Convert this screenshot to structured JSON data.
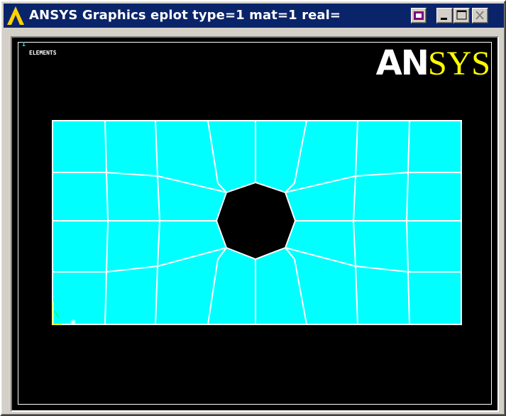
{
  "window": {
    "title": "ANSYS Graphics   eplot   type=1  mat=1  real=",
    "buttons": [
      "menu-toggle",
      "minimize",
      "maximize",
      "close"
    ]
  },
  "plot": {
    "window_number": "1",
    "label": "ELEMENTS",
    "logo_left": "AN",
    "logo_right": "SYS",
    "colors": {
      "background": "#000000",
      "mesh_fill": "#00ffff",
      "mesh_lines": "#ffffff",
      "logo_left": "#ffffff",
      "logo_right": "#ffff00",
      "triad": "#ffff00"
    }
  },
  "icons": [
    "ansys-logo-icon",
    "menu-icon",
    "minimize-icon",
    "maximize-icon",
    "close-icon",
    "triad-icon"
  ]
}
